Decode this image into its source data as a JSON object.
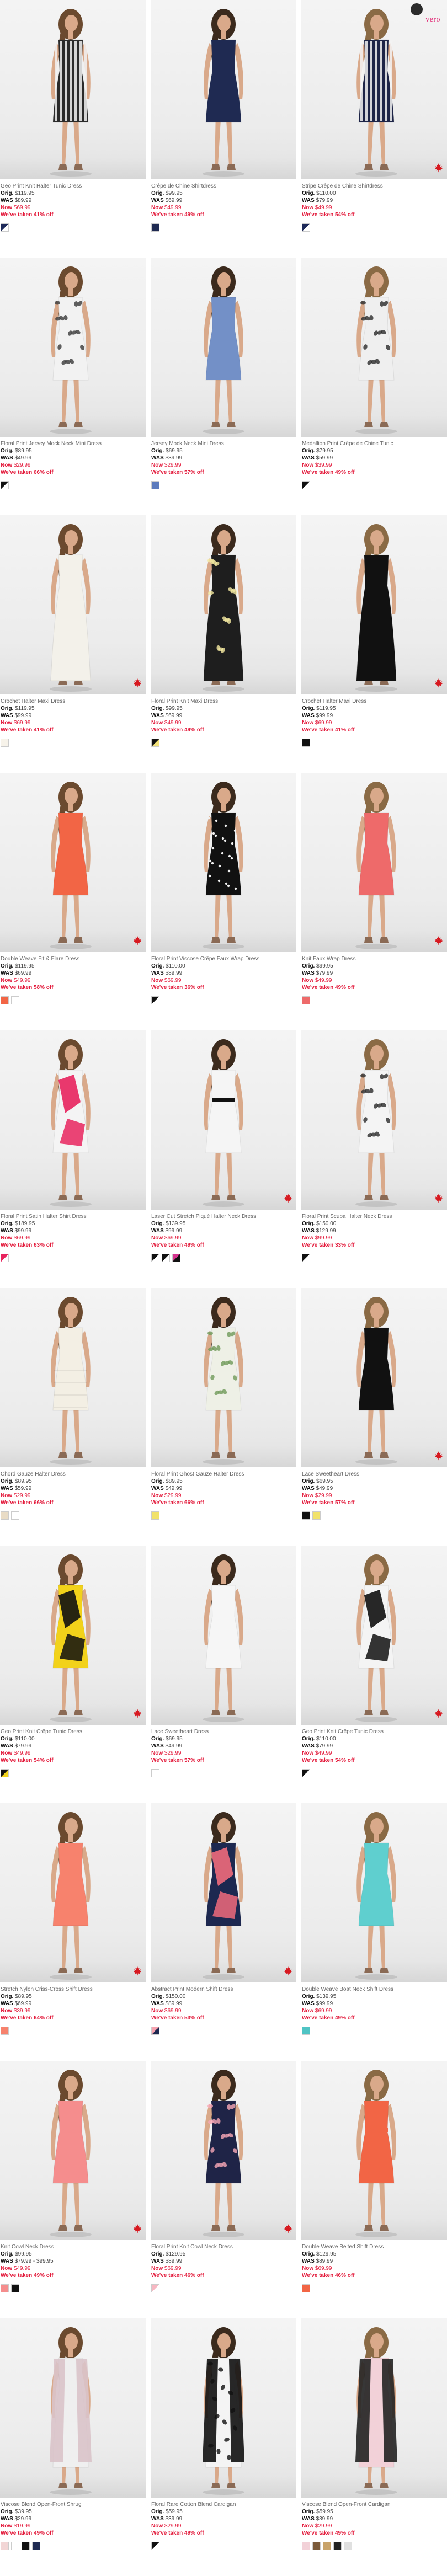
{
  "colors": {
    "sale_red": "#e31b3c",
    "vero_pink": "#e12c77"
  },
  "brand_badge": {
    "top": "",
    "wordmark": "vero"
  },
  "products": [
    {
      "name": "Geo Print Knit Halter Tunic Dress",
      "orig_label": "Orig.",
      "orig": "$119.95",
      "was_label": "WAS",
      "was": "$89.99",
      "now_label": "Now",
      "now": "$69.99",
      "taken": "We've taken 41% off",
      "dress": "#2a2a2a",
      "dress2": "#f2f2f2",
      "style": "stripe",
      "swatches": [
        {
          "type": "split",
          "a": "#1e2a5a",
          "b": "#ffffff"
        }
      ],
      "maple": false
    },
    {
      "name": "Crêpe de Chine Shirtdress",
      "orig_label": "Orig.",
      "orig": "$99.95",
      "was_label": "WAS",
      "was": "$69.99",
      "now_label": "Now",
      "now": "$49.99",
      "taken": "We've taken 49% off",
      "dress": "#1f2a52",
      "dress2": "#1f2a52",
      "style": "solid",
      "swatches": [
        {
          "type": "solid",
          "a": "#1f2a52"
        }
      ],
      "maple": false
    },
    {
      "name": "Stripe Crêpe de Chine Shirtdress",
      "orig_label": "Orig.",
      "orig": "$110.00",
      "was_label": "WAS",
      "was": "$79.99",
      "now_label": "Now",
      "now": "$49.99",
      "taken": "We've taken 54% off",
      "dress": "#1d2447",
      "dress2": "#f3f3f3",
      "style": "stripe",
      "swatches": [
        {
          "type": "split",
          "a": "#1e2a5a",
          "b": "#ffffff"
        }
      ],
      "maple": true,
      "badge": true
    },
    {
      "name": "Floral Print Jersey Mock Neck Mini Dress",
      "orig_label": "Orig.",
      "orig": "$89.95",
      "was_label": "WAS",
      "was": "$49.99",
      "now_label": "Now",
      "now": "$29.99",
      "taken": "We've taken 66% off",
      "dress": "#f2f2f2",
      "dress2": "#3a3a3a",
      "style": "print",
      "swatches": [
        {
          "type": "split",
          "a": "#111111",
          "b": "#ffffff"
        }
      ],
      "maple": false
    },
    {
      "name": "Jersey Mock Neck Mini Dress",
      "orig_label": "Orig.",
      "orig": "$69.95",
      "was_label": "WAS",
      "was": "$39.99",
      "now_label": "Now",
      "now": "$29.99",
      "taken": "We've taken 57% off",
      "dress": "#7390c7",
      "dress2": "#7390c7",
      "style": "solid",
      "swatches": [
        {
          "type": "solid",
          "a": "#5d7bbd"
        }
      ],
      "maple": false
    },
    {
      "name": "Medallion Print Crêpe de Chine Tunic",
      "orig_label": "Orig.",
      "orig": "$79.95",
      "was_label": "WAS",
      "was": "$59.99",
      "now_label": "Now",
      "now": "$39.99",
      "taken": "We've taken 49% off",
      "dress": "#efefef",
      "dress2": "#2a2a2a",
      "style": "print",
      "swatches": [
        {
          "type": "split",
          "a": "#111111",
          "b": "#ffffff"
        }
      ],
      "maple": false
    },
    {
      "name": "Crochet Halter Maxi Dress",
      "orig_label": "Orig.",
      "orig": "$119.95",
      "was_label": "WAS",
      "was": "$99.99",
      "now_label": "Now",
      "now": "$69.99",
      "taken": "We've taken 41% off",
      "dress": "#f3f1ea",
      "dress2": "#f3f1ea",
      "style": "maxi",
      "swatches": [
        {
          "type": "solid",
          "a": "#f7f3ea"
        }
      ],
      "maple": true
    },
    {
      "name": "Floral Print Knit Maxi Dress",
      "orig_label": "Orig.",
      "orig": "$99.95",
      "was_label": "WAS",
      "was": "$69.99",
      "now_label": "Now",
      "now": "$49.99",
      "taken": "We've taken 49% off",
      "dress": "#1e1e1e",
      "dress2": "#f4e9a0",
      "style": "maxiprint",
      "swatches": [
        {
          "type": "split",
          "a": "#111111",
          "b": "#f3e27a"
        }
      ],
      "maple": false
    },
    {
      "name": "Crochet Halter Maxi Dress",
      "orig_label": "Orig.",
      "orig": "$119.95",
      "was_label": "WAS",
      "was": "$99.99",
      "now_label": "Now",
      "now": "$69.99",
      "taken": "We've taken 41% off",
      "dress": "#111111",
      "dress2": "#111111",
      "style": "maxi",
      "swatches": [
        {
          "type": "solid",
          "a": "#111111"
        }
      ],
      "maple": true
    },
    {
      "name": "Double Weave Fit & Flare Dress",
      "orig_label": "Orig.",
      "orig": "$119.95",
      "was_label": "WAS",
      "was": "$69.99",
      "now_label": "Now",
      "now": "$49.99",
      "taken": "We've taken 58% off",
      "dress": "#f26545",
      "dress2": "#f26545",
      "style": "solid",
      "swatches": [
        {
          "type": "solid",
          "a": "#f26545"
        },
        {
          "type": "solid",
          "a": "#ffffff"
        }
      ],
      "maple": true
    },
    {
      "name": "Floral Print Viscose Crêpe Faux Wrap Dress",
      "orig_label": "Orig.",
      "orig": "$110.00",
      "was_label": "WAS",
      "was": "$89.99",
      "now_label": "Now",
      "now": "$69.99",
      "taken": "We've taken 36% off",
      "dress": "#111111",
      "dress2": "#f0f0f0",
      "style": "dots",
      "swatches": [
        {
          "type": "split",
          "a": "#111111",
          "b": "#ffffff"
        }
      ],
      "maple": false
    },
    {
      "name": "Knit Faux Wrap Dress",
      "orig_label": "Orig.",
      "orig": "$99.95",
      "was_label": "WAS",
      "was": "$79.99",
      "now_label": "Now",
      "now": "$49.99",
      "taken": "We've taken 49% off",
      "dress": "#ee6a6a",
      "dress2": "#ee6a6a",
      "style": "solid",
      "swatches": [
        {
          "type": "solid",
          "a": "#ee6a6a"
        }
      ],
      "maple": true
    },
    {
      "name": "Floral Print Satin Halter Shirt Dress",
      "orig_label": "Orig.",
      "orig": "$189.95",
      "was_label": "WAS",
      "was": "$99.99",
      "now_label": "Now",
      "now": "$69.99",
      "taken": "We've taken 63% off",
      "dress": "#f4f4f4",
      "dress2": "#e8245e",
      "style": "bold",
      "swatches": [
        {
          "type": "split",
          "a": "#e8245e",
          "b": "#ffffff"
        }
      ],
      "maple": false
    },
    {
      "name": "Laser Cut Stretch Piqué Halter Neck Dress",
      "orig_label": "Orig.",
      "orig": "$139.95",
      "was_label": "WAS",
      "was": "$99.99",
      "now_label": "Now",
      "now": "$69.99",
      "taken": "We've taken 49% off",
      "dress": "#f5f5f5",
      "dress2": "#111111",
      "style": "belted",
      "swatches": [
        {
          "type": "split",
          "a": "#111111",
          "b": "#ffffff"
        },
        {
          "type": "split",
          "a": "#111111",
          "b": "#ffffff"
        },
        {
          "type": "split",
          "a": "#d6338f",
          "b": "#111111"
        }
      ],
      "maple": true
    },
    {
      "name": "Floral Print Scuba Halter Neck Dress",
      "orig_label": "Orig.",
      "orig": "$150.00",
      "was_label": "WAS",
      "was": "$129.99",
      "now_label": "Now",
      "now": "$99.99",
      "taken": "We've taken 33% off",
      "dress": "#f4f4f4",
      "dress2": "#2a2a2a",
      "style": "print",
      "swatches": [
        {
          "type": "split",
          "a": "#111111",
          "b": "#ffffff"
        }
      ],
      "maple": true
    },
    {
      "name": "Chord Gauze Halter Dress",
      "orig_label": "Orig.",
      "orig": "$89.95",
      "was_label": "WAS",
      "was": "$59.99",
      "now_label": "Now",
      "now": "$29.99",
      "taken": "We've taken 66% off",
      "dress": "#f3efe4",
      "dress2": "#f3efe4",
      "style": "tier",
      "swatches": [
        {
          "type": "solid",
          "a": "#e9dcc6"
        },
        {
          "type": "solid",
          "a": "#ffffff"
        }
      ],
      "maple": false
    },
    {
      "name": "Floral Print Ghost Gauze Halter Dress",
      "orig_label": "Orig.",
      "orig": "$89.95",
      "was_label": "WAS",
      "was": "$49.99",
      "now_label": "Now",
      "now": "$29.99",
      "taken": "We've taken 66% off",
      "dress": "#eef0e6",
      "dress2": "#6f9a5a",
      "style": "print",
      "swatches": [
        {
          "type": "solid",
          "a": "#f1e26b"
        }
      ],
      "maple": false
    },
    {
      "name": "Lace Sweetheart Dress",
      "orig_label": "Orig.",
      "orig": "$69.95",
      "was_label": "WAS",
      "was": "$49.99",
      "now_label": "Now",
      "now": "$29.99",
      "taken": "We've taken 57% off",
      "dress": "#111111",
      "dress2": "#111111",
      "style": "solid",
      "swatches": [
        {
          "type": "solid",
          "a": "#111111"
        },
        {
          "type": "solid",
          "a": "#f1e26b"
        }
      ],
      "maple": true
    },
    {
      "name": "Geo Print Knit Crêpe Tunic Dress",
      "orig_label": "Orig.",
      "orig": "$110.00",
      "was_label": "WAS",
      "was": "$79.99",
      "now_label": "Now",
      "now": "$49.99",
      "taken": "We've taken 54% off",
      "dress": "#f2d21a",
      "dress2": "#111111",
      "style": "geo",
      "swatches": [
        {
          "type": "split",
          "a": "#111111",
          "b": "#f2d21a"
        }
      ],
      "maple": true
    },
    {
      "name": "Lace Sweetheart Dress",
      "orig_label": "Orig.",
      "orig": "$69.95",
      "was_label": "WAS",
      "was": "$49.99",
      "now_label": "Now",
      "now": "$29.99",
      "taken": "We've taken 57% off",
      "dress": "#f6f6f6",
      "dress2": "#f6f6f6",
      "style": "solid",
      "swatches": [
        {
          "type": "solid",
          "a": "#ffffff"
        }
      ],
      "maple": false
    },
    {
      "name": "Geo Print Knit Crêpe Tunic Dress",
      "orig_label": "Orig.",
      "orig": "$110.00",
      "was_label": "WAS",
      "was": "$79.99",
      "now_label": "Now",
      "now": "$49.99",
      "taken": "We've taken 54% off",
      "dress": "#f4f4f4",
      "dress2": "#111111",
      "style": "geo",
      "swatches": [
        {
          "type": "split",
          "a": "#111111",
          "b": "#ffffff"
        }
      ],
      "maple": true
    },
    {
      "name": "Stretch Nylon Criss-Cross Shift Dress",
      "orig_label": "Orig.",
      "orig": "$89.95",
      "was_label": "WAS",
      "was": "$69.99",
      "now_label": "Now",
      "now": "$39.99",
      "taken": "We've taken 64% off",
      "dress": "#f7826d",
      "dress2": "#f7826d",
      "style": "solid",
      "swatches": [
        {
          "type": "solid",
          "a": "#f7826d"
        }
      ],
      "maple": true
    },
    {
      "name": "Abstract Print Modern Shift Dress",
      "orig_label": "Orig.",
      "orig": "$150.00",
      "was_label": "WAS",
      "was": "$89.99",
      "now_label": "Now",
      "now": "$69.99",
      "taken": "We've taken 53% off",
      "dress": "#1d2850",
      "dress2": "#f06a7b",
      "style": "bold",
      "swatches": [
        {
          "type": "split",
          "a": "#f7a3b0",
          "b": "#1d2850"
        }
      ],
      "maple": true
    },
    {
      "name": "Double Weave Boat Neck Shift Dress",
      "orig_label": "Orig.",
      "orig": "$139.95",
      "was_label": "WAS",
      "was": "$99.99",
      "now_label": "Now",
      "now": "$69.99",
      "taken": "We've taken 49% off",
      "dress": "#5fcfcf",
      "dress2": "#5fcfcf",
      "style": "solid",
      "swatches": [
        {
          "type": "solid",
          "a": "#4fc4c4"
        }
      ],
      "maple": false
    },
    {
      "name": "Knit Cowl Neck Dress",
      "orig_label": "Orig.",
      "orig": "$99.95",
      "was_label": "WAS",
      "was": "$79.99 - $99.95",
      "now_label": "Now",
      "now": "$49.99",
      "taken": "We've taken 49% off",
      "dress": "#f58d8d",
      "dress2": "#f58d8d",
      "style": "solid",
      "swatches": [
        {
          "type": "solid",
          "a": "#f58d8d"
        },
        {
          "type": "solid",
          "a": "#111111"
        }
      ],
      "maple": true
    },
    {
      "name": "Floral Print Knit Cowl Neck Dress",
      "orig_label": "Orig.",
      "orig": "$129.95",
      "was_label": "WAS",
      "was": "$89.99",
      "now_label": "Now",
      "now": "$69.99",
      "taken": "We've taken 46% off",
      "dress": "#1f2447",
      "dress2": "#f7a7b6",
      "style": "print",
      "swatches": [
        {
          "type": "split",
          "a": "#f7b7c2",
          "b": "#ffffff"
        }
      ],
      "maple": true
    },
    {
      "name": "Double Weave Belted Shift Dress",
      "orig_label": "Orig.",
      "orig": "$129.95",
      "was_label": "WAS",
      "was": "$89.99",
      "now_label": "Now",
      "now": "$69.99",
      "taken": "We've taken 46% off",
      "dress": "#f26545",
      "dress2": "#f26545",
      "style": "belted",
      "swatches": [
        {
          "type": "solid",
          "a": "#f26545"
        }
      ],
      "maple": false
    },
    {
      "name": "Viscose Blend Open-Front Shrug",
      "orig_label": "Orig.",
      "orig": "$39.95",
      "was_label": "WAS",
      "was": "$29.99",
      "now_label": "Now",
      "now": "$19.99",
      "taken": "We've taken 49% off",
      "dress": "#efefef",
      "dress2": "#d9c3c9",
      "style": "cardigan",
      "swatches": [
        {
          "type": "solid",
          "a": "#f2d6d6"
        },
        {
          "type": "solid",
          "a": "#ffffff"
        },
        {
          "type": "solid",
          "a": "#111111"
        },
        {
          "type": "solid",
          "a": "#1f2a52"
        }
      ],
      "maple": false
    },
    {
      "name": "Floral Rare Cotton Blend Cardigan",
      "orig_label": "Orig.",
      "orig": "$59.95",
      "was_label": "WAS",
      "was": "$39.99",
      "now_label": "Now",
      "now": "$29.99",
      "taken": "We've taken 49% off",
      "dress": "#f4f4f4",
      "dress2": "#111111",
      "style": "cardiprint",
      "swatches": [
        {
          "type": "split",
          "a": "#111111",
          "b": "#ffffff"
        }
      ],
      "maple": false
    },
    {
      "name": "Viscose Blend Open-Front Cardigan",
      "orig_label": "Orig.",
      "orig": "$59.95",
      "was_label": "WAS",
      "was": "$39.99",
      "now_label": "Now",
      "now": "$29.99",
      "taken": "We've taken 49% off",
      "dress": "#f2d1d8",
      "dress2": "#222222",
      "style": "cardigan",
      "swatches": [
        {
          "type": "solid",
          "a": "#f2d1d8"
        },
        {
          "type": "solid",
          "a": "#7b5a3a"
        },
        {
          "type": "solid",
          "a": "#c8a36a"
        },
        {
          "type": "solid",
          "a": "#222222"
        },
        {
          "type": "solid",
          "a": "#e0e0e0"
        }
      ],
      "maple": false
    }
  ]
}
